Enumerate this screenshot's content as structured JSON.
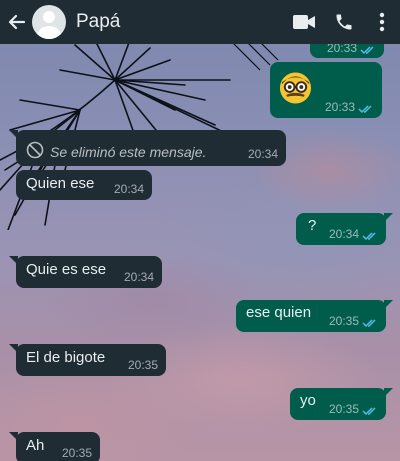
{
  "header": {
    "contact_name": "Papá",
    "back_icon": "arrow-left-icon",
    "video_icon": "video-camera-icon",
    "call_icon": "phone-icon",
    "menu_icon": "more-vertical-icon"
  },
  "colors": {
    "header_bg": "#1f2c34",
    "incoming_bubble": "#1f2c34",
    "outgoing_bubble": "#005c4b",
    "read_ticks": "#53bdeb"
  },
  "messages": [
    {
      "direction": "out",
      "text": "",
      "time": "20:33",
      "ticks": "read"
    },
    {
      "direction": "out",
      "emoji": "nerd-face",
      "time": "20:33",
      "ticks": "read"
    },
    {
      "direction": "in",
      "deleted": true,
      "text": "Se eliminó este mensaje.",
      "time": "20:34",
      "icon": "prohibited-icon"
    },
    {
      "direction": "in",
      "text": "Quien ese",
      "time": "20:34"
    },
    {
      "direction": "out",
      "text": "?",
      "time": "20:34",
      "ticks": "read"
    },
    {
      "direction": "in",
      "text": "Quie es ese",
      "time": "20:34"
    },
    {
      "direction": "out",
      "text": "ese quien",
      "time": "20:35",
      "ticks": "read"
    },
    {
      "direction": "in",
      "text": "El de bigote",
      "time": "20:35"
    },
    {
      "direction": "out",
      "text": "yo",
      "time": "20:35",
      "ticks": "read"
    },
    {
      "direction": "in",
      "text": "Ah",
      "time": "20:35"
    }
  ]
}
